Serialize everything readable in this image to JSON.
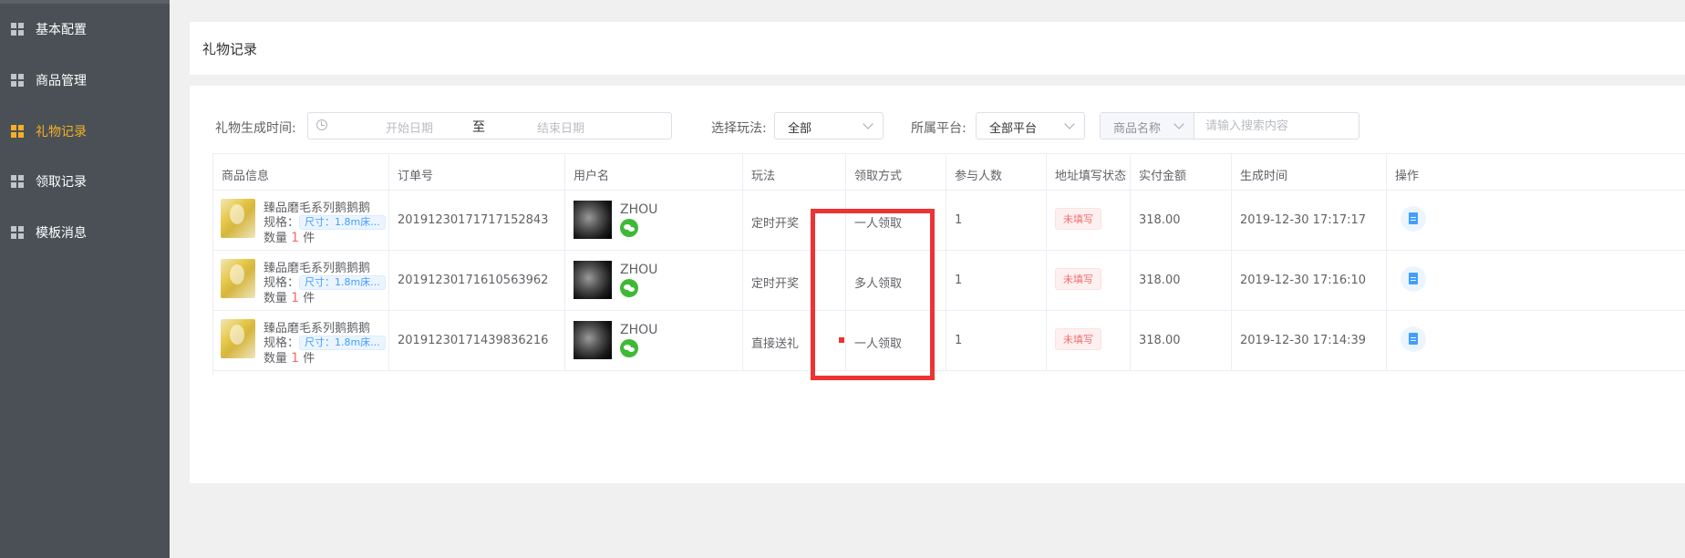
{
  "sidebar": {
    "items": [
      {
        "label": "基本配置",
        "active": false
      },
      {
        "label": "商品管理",
        "active": false
      },
      {
        "label": "礼物记录",
        "active": true
      },
      {
        "label": "领取记录",
        "active": false
      },
      {
        "label": "模板消息",
        "active": false
      }
    ]
  },
  "page": {
    "title": "礼物记录"
  },
  "filters": {
    "time_label": "礼物生成时间:",
    "start_placeholder": "开始日期",
    "range_separator": "至",
    "end_placeholder": "结束日期",
    "play_label": "选择玩法:",
    "play_value": "全部",
    "platform_label": "所属平台:",
    "platform_value": "全部平台",
    "search_field_value": "商品名称",
    "search_placeholder": "请输入搜索内容"
  },
  "table": {
    "columns": [
      "商品信息",
      "订单号",
      "用户名",
      "玩法",
      "领取方式",
      "参与人数",
      "地址填写状态",
      "实付金额",
      "生成时间",
      "操作"
    ],
    "rows": [
      {
        "product_name": "臻品磨毛系列鹅鹅鹅",
        "spec_label": "规格：",
        "spec_value": "尺寸：1.8m床...",
        "qty_label": "数量",
        "qty": "1",
        "qty_unit": "件",
        "order_no": "20191230171717152843",
        "username": "ZHOU",
        "play": "定时开奖",
        "receive_mode": "一人领取",
        "participants": "1",
        "address_status": "未填写",
        "amount": "318.00",
        "created": "2019-12-30 17:17:17"
      },
      {
        "product_name": "臻品磨毛系列鹅鹅鹅",
        "spec_label": "规格：",
        "spec_value": "尺寸：1.8m床...",
        "qty_label": "数量",
        "qty": "1",
        "qty_unit": "件",
        "order_no": "20191230171610563962",
        "username": "ZHOU",
        "play": "定时开奖",
        "receive_mode": "多人领取",
        "participants": "1",
        "address_status": "未填写",
        "amount": "318.00",
        "created": "2019-12-30 17:16:10"
      },
      {
        "product_name": "臻品磨毛系列鹅鹅鹅",
        "spec_label": "规格：",
        "spec_value": "尺寸：1.8m床...",
        "qty_label": "数量",
        "qty": "1",
        "qty_unit": "件",
        "order_no": "20191230171439836216",
        "username": "ZHOU",
        "play": "直接送礼",
        "receive_mode": "一人领取",
        "participants": "1",
        "address_status": "未填写",
        "amount": "318.00",
        "created": "2019-12-30 17:14:39"
      }
    ]
  },
  "colors": {
    "sidebar_bg": "#4a5056",
    "active_accent": "#f5b025",
    "highlight": "#ee3333",
    "link_blue": "#409eff",
    "danger": "#f56c6c",
    "wechat_green": "#3eb935"
  }
}
